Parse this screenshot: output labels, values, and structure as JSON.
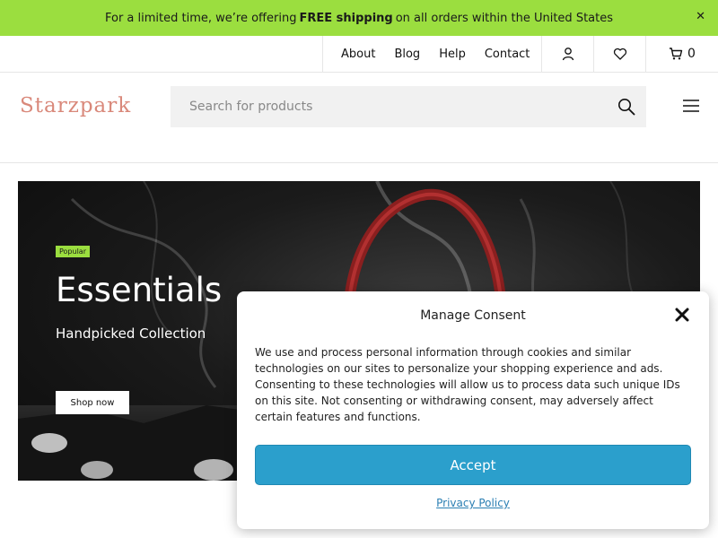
{
  "announcement": {
    "text_before": "For a limited time, we’re offering",
    "text_bold": "FREE shipping",
    "text_after": "on all orders within the United States",
    "close_label": "✕"
  },
  "topnav": {
    "links": [
      "About",
      "Blog",
      "Help",
      "Contact"
    ],
    "cart_count": "0",
    "icons": [
      "user-icon",
      "heart-icon",
      "cart-icon"
    ]
  },
  "header": {
    "logo": "Starzpark",
    "search_placeholder": "Search for products",
    "icons": [
      "search-icon",
      "menu-icon"
    ]
  },
  "hero": {
    "badge": "Popular",
    "title": "Essentials",
    "subtitle": "Handpicked Collection",
    "button": "Shop now"
  },
  "consent": {
    "title": "Manage Consent",
    "body": "We use and process personal information through cookies and similar technologies on our sites to personalize your shopping experience and ads.  Consenting to these technologies will allow us to process data such unique IDs on this site. Not consenting or withdrawing consent, may adversely affect certain features and functions.",
    "accept": "Accept",
    "privacy": "Privacy Policy"
  },
  "colors": {
    "accent_green": "#9bde3f",
    "logo": "#d9887a",
    "accept_button": "#2b9fcc",
    "link": "#2b7fb3"
  }
}
